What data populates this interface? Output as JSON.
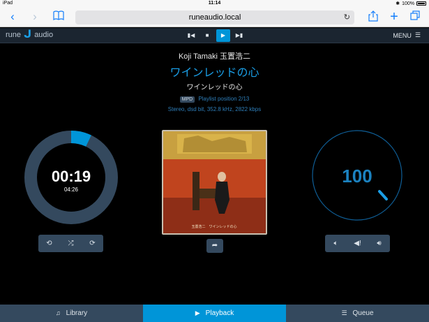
{
  "status": {
    "device": "iPad",
    "time": "11:14",
    "battery": "100%"
  },
  "browser": {
    "url": "runeaudio.local"
  },
  "header": {
    "logo_left": "rune",
    "logo_right": "audio",
    "menu_label": "MENU"
  },
  "track": {
    "artist": "Koji Tamaki 玉置浩二",
    "title": "ワインレッドの心",
    "album": "ワインレッドの心",
    "source_badge": "MPD",
    "playlist_position": "Playlist position 2/13",
    "format": "Stereo, dsd bit, 352.8 kHz, 2822 kbps"
  },
  "timer": {
    "elapsed": "00:19",
    "total": "04:26",
    "progress": 0.071
  },
  "volume": {
    "value": "100",
    "level": 1.0
  },
  "tabs": [
    {
      "label": "Library",
      "icon": "music-note-icon"
    },
    {
      "label": "Playback",
      "icon": "play-icon"
    },
    {
      "label": "Queue",
      "icon": "list-icon"
    }
  ],
  "colors": {
    "accent": "#0095d8",
    "panel": "#34495e",
    "header": "#1b2530",
    "ring_track": "#34495e"
  }
}
